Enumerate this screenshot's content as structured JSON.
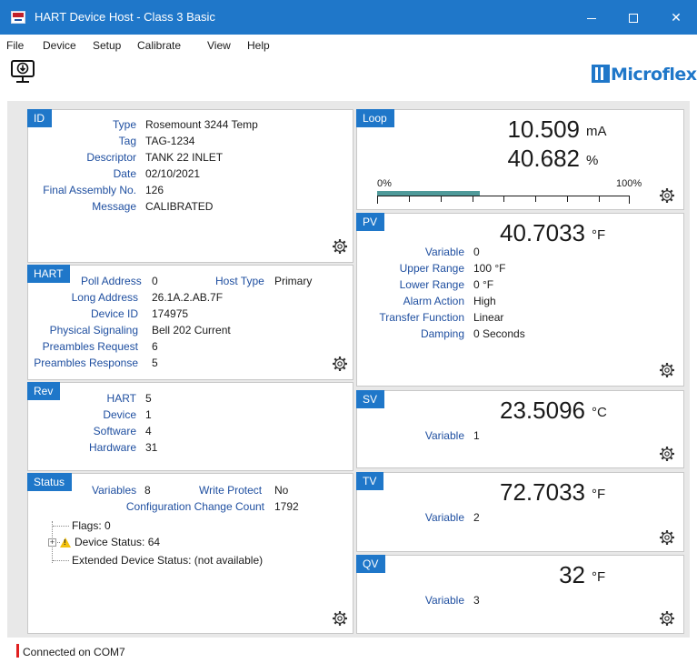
{
  "window": {
    "title": "HART Device Host - Class 3 Basic",
    "controls": {
      "minimize": "",
      "maximize": "",
      "close": "✕"
    }
  },
  "menu": [
    "File",
    "Device",
    "Setup",
    "Calibrate",
    "View",
    "Help"
  ],
  "toolbar": {
    "connect_icon": "monitor-download-icon",
    "logo_text": "Microflex"
  },
  "colors": {
    "accent": "#1f77c9",
    "bar_fill": "#4f9a9a",
    "label_text": "#1f4fa0",
    "status_indicator": "#e02020",
    "warning": "#f4c20d"
  },
  "id_panel": {
    "tag": "ID",
    "fields": [
      {
        "label": "Type",
        "value": "Rosemount 3244 Temp"
      },
      {
        "label": "Tag",
        "value": "TAG-1234"
      },
      {
        "label": "Descriptor",
        "value": "TANK 22 INLET"
      },
      {
        "label": "Date",
        "value": "02/10/2021"
      },
      {
        "label": "Final Assembly No.",
        "value": "126"
      },
      {
        "label": "Message",
        "value": "CALIBRATED"
      }
    ]
  },
  "hart_panel": {
    "tag": "HART",
    "poll_address_label": "Poll Address",
    "poll_address": "0",
    "host_type_label": "Host Type",
    "host_type": "Primary",
    "fields": [
      {
        "label": "Long Address",
        "value": "26.1A.2.AB.7F"
      },
      {
        "label": "Device ID",
        "value": "174975"
      },
      {
        "label": "Physical Signaling",
        "value": "Bell 202 Current"
      },
      {
        "label": "Preambles Request",
        "value": "6"
      },
      {
        "label": "Preambles Response",
        "value": "5"
      }
    ]
  },
  "rev_panel": {
    "tag": "Rev",
    "fields": [
      {
        "label": "HART",
        "value": "5"
      },
      {
        "label": "Device",
        "value": "1"
      },
      {
        "label": "Software",
        "value": "4"
      },
      {
        "label": "Hardware",
        "value": "31"
      }
    ]
  },
  "status_panel": {
    "tag": "Status",
    "variables_label": "Variables",
    "variables": "8",
    "write_protect_label": "Write Protect",
    "write_protect": "No",
    "config_change_label": "Configuration Change Count",
    "config_change": "1792",
    "tree": [
      "Flags: 0",
      "Device Status: 64",
      "Extended Device Status: (not available)"
    ]
  },
  "loop_panel": {
    "tag": "Loop",
    "current": "10.509",
    "current_unit": "mA",
    "percent": "40.682",
    "percent_unit": "%",
    "bar_min_label": "0%",
    "bar_max_label": "100%",
    "bar_fraction": 0.40682
  },
  "pv_panel": {
    "tag": "PV",
    "value": "40.7033",
    "unit": "°F",
    "fields": [
      {
        "label": "Variable",
        "value": "0"
      },
      {
        "label": "Upper Range",
        "value": "100 °F"
      },
      {
        "label": "Lower Range",
        "value": "0 °F"
      },
      {
        "label": "Alarm Action",
        "value": "High"
      },
      {
        "label": "Transfer Function",
        "value": "Linear"
      },
      {
        "label": "Damping",
        "value": "0 Seconds"
      }
    ]
  },
  "sv_panel": {
    "tag": "SV",
    "value": "23.5096",
    "unit": "°C",
    "variable_label": "Variable",
    "variable": "1"
  },
  "tv_panel": {
    "tag": "TV",
    "value": "72.7033",
    "unit": "°F",
    "variable_label": "Variable",
    "variable": "2"
  },
  "qv_panel": {
    "tag": "QV",
    "value": "32",
    "unit": "°F",
    "variable_label": "Variable",
    "variable": "3"
  },
  "statusbar": {
    "text": "Connected on COM7"
  }
}
